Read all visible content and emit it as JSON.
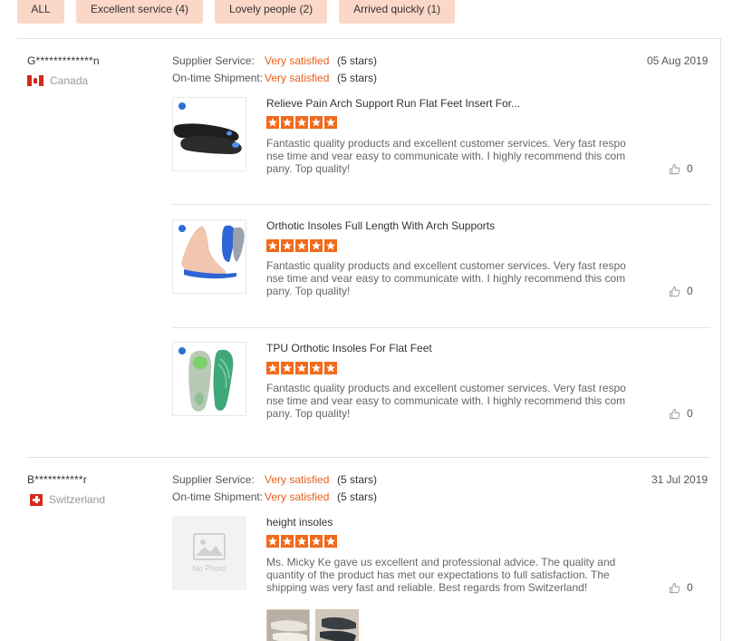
{
  "filters": [
    {
      "label": "ALL"
    },
    {
      "label": "Excellent service (4)"
    },
    {
      "label": "Lovely people (2)"
    },
    {
      "label": "Arrived quickly (1)"
    }
  ],
  "reviews": [
    {
      "reviewer": "G*************n",
      "country": "Canada",
      "supplier_service_label": "Supplier Service:",
      "supplier_service_value": "Very satisfied",
      "supplier_service_stars": "(5 stars)",
      "ontime_label": "On-time Shipment:",
      "ontime_value": "Very satisfied",
      "ontime_stars": "(5 stars)",
      "date": "05 Aug 2019",
      "products": [
        {
          "title": "Relieve Pain Arch Support Run Flat Feet Insert For...",
          "rating": 5,
          "text": "Fantastic quality products and excellent customer services. Very fast response time and vear easy to communicate with.  I highly recommend this company. Top quality!",
          "likes": "0",
          "image_icon": "black-insoles-image"
        },
        {
          "title": "Orthotic Insoles Full Length With Arch Supports",
          "rating": 5,
          "text": "Fantastic quality products and excellent customer services. Very fast response time and vear easy to communicate with.  I highly recommend this company. Top quality!",
          "likes": "0",
          "image_icon": "blue-insoles-foot-image"
        },
        {
          "title": "TPU Orthotic Insoles For Flat Feet",
          "rating": 5,
          "text": "Fantastic quality products and excellent customer services. Very fast response time and vear easy to communicate with.  I highly recommend this company. Top quality!",
          "likes": "0",
          "image_icon": "green-insoles-image"
        }
      ]
    },
    {
      "reviewer": "B***********r",
      "country": "Switzerland",
      "supplier_service_label": "Supplier Service:",
      "supplier_service_value": "Very satisfied",
      "supplier_service_stars": "(5 stars)",
      "ontime_label": "On-time Shipment:",
      "ontime_value": "Very satisfied",
      "ontime_stars": "(5 stars)",
      "date": "31 Jul 2019",
      "products": [
        {
          "title": "height insoles",
          "rating": 5,
          "text": "Ms. Micky Ke gave us excellent and professional advice. The quality and quantity of the product has met our expectations to full satisfaction. The shipping was very fast and reliable. Best regards from Switzerland!",
          "likes": "0",
          "image_icon": "no-photo-placeholder",
          "no_photo_label": "No Photo"
        }
      ]
    }
  ],
  "colors": {
    "accent": "#e8601c",
    "star": "#f26a1b",
    "chip_bg": "#fbd7c8",
    "divider": "#e3e3e3"
  }
}
